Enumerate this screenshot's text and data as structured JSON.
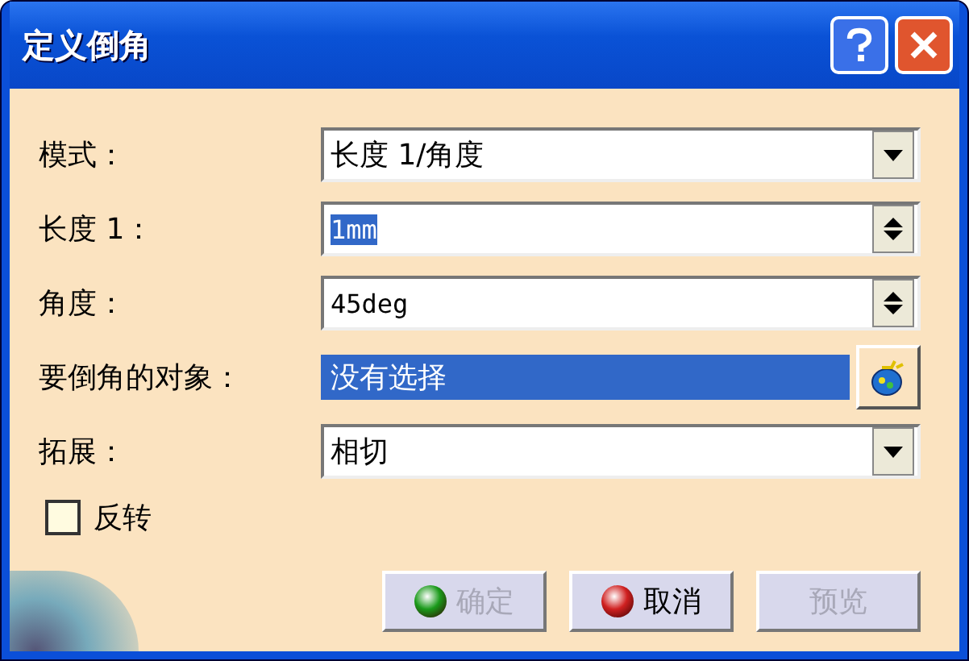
{
  "window": {
    "title": "定义倒角"
  },
  "fields": [
    {
      "kind": "dropdown",
      "label": "模式：",
      "value": "长度 1/角度",
      "selected": false
    },
    {
      "kind": "spinner",
      "label": "长度 1：",
      "value": "1mm",
      "selected": true
    },
    {
      "kind": "spinner",
      "label": "角度：",
      "value": "45deg",
      "selected": false
    },
    {
      "kind": "selection",
      "label": "要倒角的对象：",
      "value": "没有选择",
      "selected": true
    },
    {
      "kind": "dropdown",
      "label": "拓展：",
      "value": "相切",
      "selected": false
    }
  ],
  "checkbox": {
    "label": "反转",
    "checked": false
  },
  "buttons": [
    {
      "label": "确定",
      "kind": "confirm",
      "disabled": true
    },
    {
      "label": "取消",
      "kind": "cancel",
      "disabled": false
    },
    {
      "label": "预览",
      "kind": "preview",
      "disabled": true
    }
  ]
}
